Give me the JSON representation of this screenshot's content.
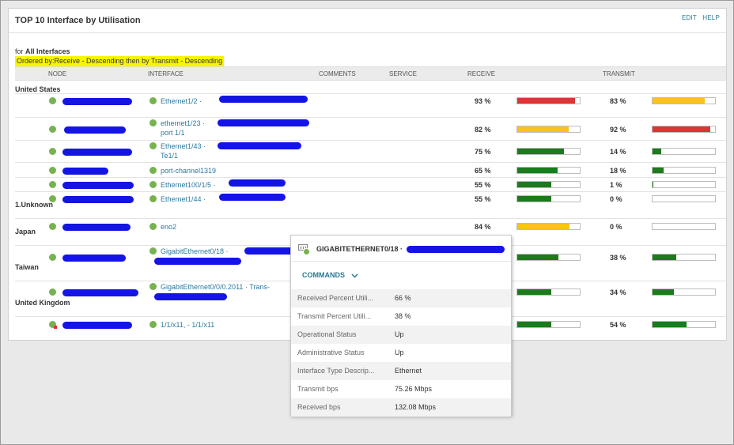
{
  "panel": {
    "title": "TOP 10 Interface by Utilisation",
    "edit_label": "EDIT",
    "help_label": "HELP",
    "for_prefix": "for ",
    "for_value": "All Interfaces",
    "ordered_by": "Ordered by:Receive - Descending then by Transmit - Descending"
  },
  "columns": {
    "node": "NODE",
    "interface": "INTERFACE",
    "comments": "COMMENTS",
    "service": "SERVICE",
    "receive": "RECEIVE",
    "transmit": "TRANSMIT"
  },
  "groups": {
    "us": "United States",
    "unknown": "1.Unknown",
    "japan": "Japan",
    "taiwan": "Taiwan",
    "uk": "United Kingdom"
  },
  "colors": {
    "bar_red": "#d93636",
    "bar_yellow": "#f7c31c",
    "bar_green": "#1d7a1d",
    "status_up": "#77b250",
    "redaction": "#1414e6",
    "highlight": "#f6f600"
  },
  "rows": [
    {
      "iface1": "Ethernet1/2 ·",
      "iface2": "",
      "receive_pct": 93,
      "receive_label": "93 %",
      "receive_color": "red",
      "transmit_pct": 83,
      "transmit_label": "83 %",
      "transmit_color": "yellow"
    },
    {
      "iface1": "ethernet1/23 ·",
      "iface2": "port 1/1",
      "receive_pct": 82,
      "receive_label": "82 %",
      "receive_color": "yellow",
      "transmit_pct": 92,
      "transmit_label": "92 %",
      "transmit_color": "red"
    },
    {
      "iface1": "Ethernet1/43 ·",
      "iface2": "Te1/1",
      "receive_pct": 75,
      "receive_label": "75 %",
      "receive_color": "green",
      "transmit_pct": 14,
      "transmit_label": "14 %",
      "transmit_color": "green"
    },
    {
      "iface1": "port-channel1319",
      "iface2": "",
      "receive_pct": 65,
      "receive_label": "65 %",
      "receive_color": "green",
      "transmit_pct": 18,
      "transmit_label": "18 %",
      "transmit_color": "green"
    },
    {
      "iface1": "Ethernet100/1/5 ·",
      "iface2": "",
      "receive_pct": 55,
      "receive_label": "55 %",
      "receive_color": "green",
      "transmit_pct": 1,
      "transmit_label": "1 %",
      "transmit_color": "green"
    },
    {
      "iface1": "Ethernet1/44 ·",
      "iface2": "",
      "receive_pct": 55,
      "receive_label": "55 %",
      "receive_color": "green",
      "transmit_pct": 0,
      "transmit_label": "0 %",
      "transmit_color": "green"
    },
    {
      "iface1": "eno2",
      "iface2": "",
      "receive_pct": 84,
      "receive_label": "84 %",
      "receive_color": "yellow",
      "transmit_pct": 0,
      "transmit_label": "0 %",
      "transmit_color": "green"
    },
    {
      "iface1": "GigabitEthernet0/18 ·",
      "iface2": "",
      "receive_pct": 66,
      "receive_label": "",
      "receive_color": "green",
      "transmit_pct": 38,
      "transmit_label": "38 %",
      "transmit_color": "green"
    },
    {
      "iface1": "GigabitEthernet0/0/0.2011 · Trans-",
      "iface2": "",
      "receive_pct": 55,
      "receive_label": "",
      "receive_color": "green",
      "transmit_pct": 34,
      "transmit_label": "34 %",
      "transmit_color": "green"
    },
    {
      "iface1": "1/1/x11, - 1/1/x11",
      "iface2": "",
      "receive_pct": 55,
      "receive_label": "",
      "receive_color": "green",
      "transmit_pct": 54,
      "transmit_label": "54 %",
      "transmit_color": "green"
    }
  ],
  "tooltip": {
    "title": "GIGABITETHERNET0/18 ·",
    "icon": "network-interface-icon",
    "commands_label": "COMMANDS",
    "details": [
      {
        "key": "Received Percent Utili...",
        "value": "66 %"
      },
      {
        "key": "Transmit Percent Utili...",
        "value": "38 %"
      },
      {
        "key": "Operational Status",
        "value": "Up"
      },
      {
        "key": "Administrative Status",
        "value": "Up"
      },
      {
        "key": "Interface Type Descrip...",
        "value": "Ethernet"
      },
      {
        "key": "Transmit bps",
        "value": "75.26 Mbps"
      },
      {
        "key": "Received bps",
        "value": "132.08 Mbps"
      }
    ]
  }
}
